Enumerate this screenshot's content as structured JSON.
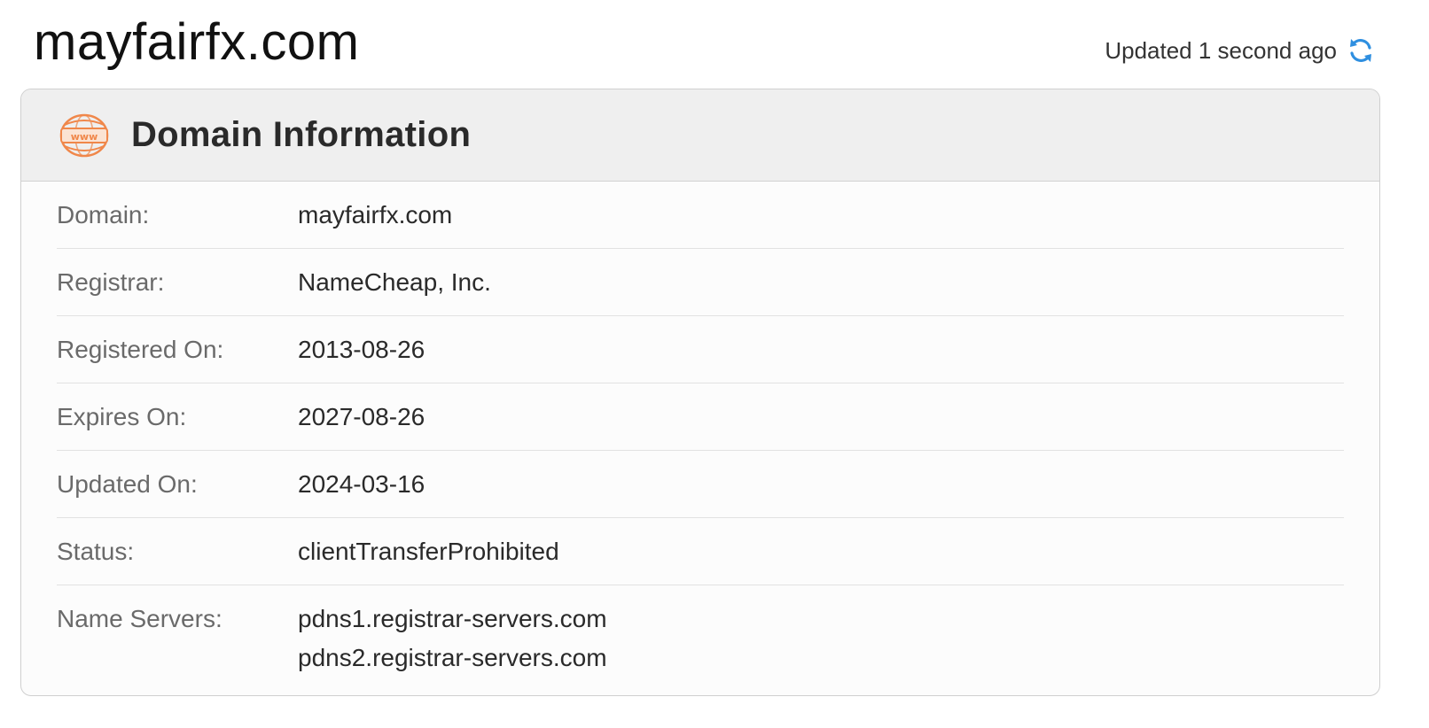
{
  "page": {
    "title": "mayfairfx.com",
    "updated_text": "Updated 1 second ago",
    "refresh_icon": "refresh-icon"
  },
  "card": {
    "icon": "www-icon",
    "title": "Domain Information",
    "rows": [
      {
        "label": "Domain:",
        "value": "mayfairfx.com"
      },
      {
        "label": "Registrar:",
        "value": "NameCheap, Inc."
      },
      {
        "label": "Registered On:",
        "value": "2013-08-26"
      },
      {
        "label": "Expires On:",
        "value": "2027-08-26"
      },
      {
        "label": "Updated On:",
        "value": "2024-03-16"
      },
      {
        "label": "Status:",
        "value": "clientTransferProhibited"
      }
    ],
    "name_servers": {
      "label": "Name Servers:",
      "values": [
        "pdns1.registrar-servers.com",
        "pdns2.registrar-servers.com"
      ]
    }
  },
  "colors": {
    "accent_icon": "#f0874a",
    "refresh_blue": "#2f8fe0",
    "header_bg": "#efefef"
  }
}
